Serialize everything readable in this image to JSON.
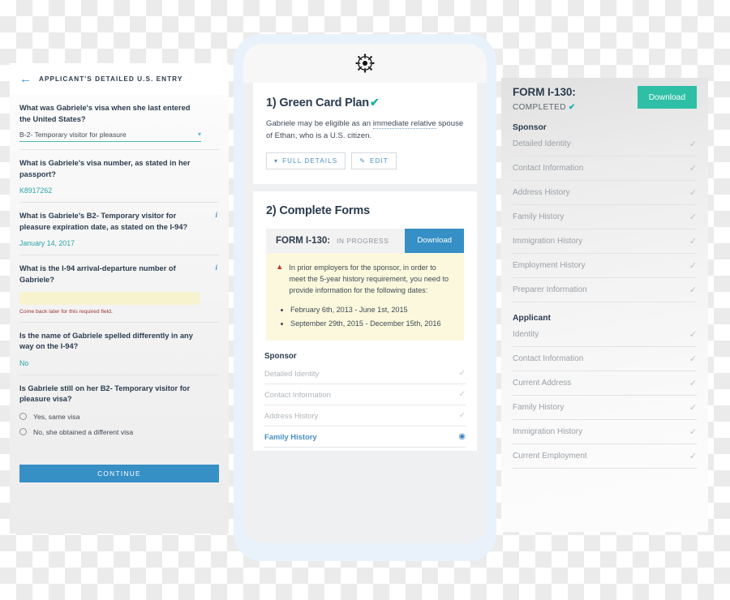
{
  "left_panel": {
    "header": {
      "back_icon": "arrow-left-icon",
      "title": "APPLICANT'S DETAILED U.S. ENTRY"
    },
    "questions": [
      {
        "label": "What was Gabriele's visa when she last entered the United States?",
        "type": "select",
        "value": "B-2- Temporary visitor for pleasure",
        "caret": "⌄",
        "info": false
      },
      {
        "label": "What is Gabriele's visa number, as stated in her passport?",
        "type": "text",
        "value": "K8917262",
        "info": false
      },
      {
        "label": "What is Gabriele's B2- Temporary visitor for pleasure expiration date, as stated on the I-94?",
        "type": "text",
        "value": "January 14, 2017",
        "info": true,
        "info_glyph": "i"
      },
      {
        "label": "What is the I-94 arrival-departure number of Gabriele?",
        "type": "empty-input",
        "value": "",
        "error": "Come back later for this required field.",
        "info": true,
        "info_glyph": "i"
      },
      {
        "label": "Is the name of Gabriele spelled differently in any way on the I-94?",
        "type": "text",
        "value": "No",
        "info": false
      },
      {
        "label": "Is Gabriele still on her B2- Temporary visitor for pleasure visa?",
        "type": "radio",
        "options": [
          "Yes, same visa",
          "No, she obtained a different visa"
        ],
        "info": false
      }
    ],
    "continue_label": "CONTINUE"
  },
  "phone": {
    "logo_icon": "ship-wheel-logo-icon",
    "plan": {
      "title": "1) Green Card Plan",
      "title_check": "✔",
      "description_prefix": "Gabriele may be eligible as an ",
      "description_link": "immediate relative",
      "description_suffix": " spouse of Ethan, who is a U.S. citizen.",
      "full_details_label": "FULL DETAILS",
      "full_details_icon": "chevron-down-icon",
      "edit_label": "EDIT",
      "edit_icon": "pencil-icon"
    },
    "forms": {
      "section_title": "2) Complete Forms",
      "form_name": "FORM I-130:",
      "form_status": "IN PROGRESS",
      "download_label": "Download",
      "warning_icon": "warning-triangle-icon",
      "warning_text": "In prior employers for the sponsor, in order to meet the 5-year history requirement, you need to provide information for the following dates:",
      "warning_dates": [
        "February 6th, 2013 - June 1st, 2015",
        "September 29th, 2015 - December 15th, 2016"
      ],
      "checklist_group": "Sponsor",
      "checklist": [
        {
          "label": "Detailed Identity",
          "state": "done",
          "mark": "✓"
        },
        {
          "label": "Contact Information",
          "state": "done",
          "mark": "✓"
        },
        {
          "label": "Address History",
          "state": "done",
          "mark": "✓"
        },
        {
          "label": "Family History",
          "state": "active",
          "mark": "◉"
        }
      ]
    }
  },
  "right_panel": {
    "form_name": "FORM I-130:",
    "status_label": "COMPLETED",
    "status_check": "✔",
    "download_label": "Download",
    "groups": [
      {
        "title": "Sponsor",
        "items": [
          {
            "label": "Detailed Identity",
            "mark": "✓"
          },
          {
            "label": "Contact Information",
            "mark": "✓"
          },
          {
            "label": "Address History",
            "mark": "✓"
          },
          {
            "label": "Family History",
            "mark": "✓"
          },
          {
            "label": "Immigration History",
            "mark": "✓"
          },
          {
            "label": "Employment History",
            "mark": "✓"
          },
          {
            "label": "Preparer Information",
            "mark": "✓"
          }
        ]
      },
      {
        "title": "Applicant",
        "items": [
          {
            "label": "Identity",
            "mark": "✓"
          },
          {
            "label": "Contact Information",
            "mark": "✓"
          },
          {
            "label": "Current Address",
            "mark": "✓"
          },
          {
            "label": "Family History",
            "mark": "✓"
          },
          {
            "label": "Immigration History",
            "mark": "✓"
          },
          {
            "label": "Current Employment",
            "mark": "✓"
          }
        ]
      }
    ]
  },
  "colors": {
    "accent_blue": "#3690c6",
    "teal": "#2aa3a8",
    "green_teal": "#2fbfa6",
    "warning_yellow": "#fbf8dd",
    "error_red": "#9d2f35",
    "phone_frame": "#e9f2fb",
    "dark_text": "#2b3c4e"
  }
}
